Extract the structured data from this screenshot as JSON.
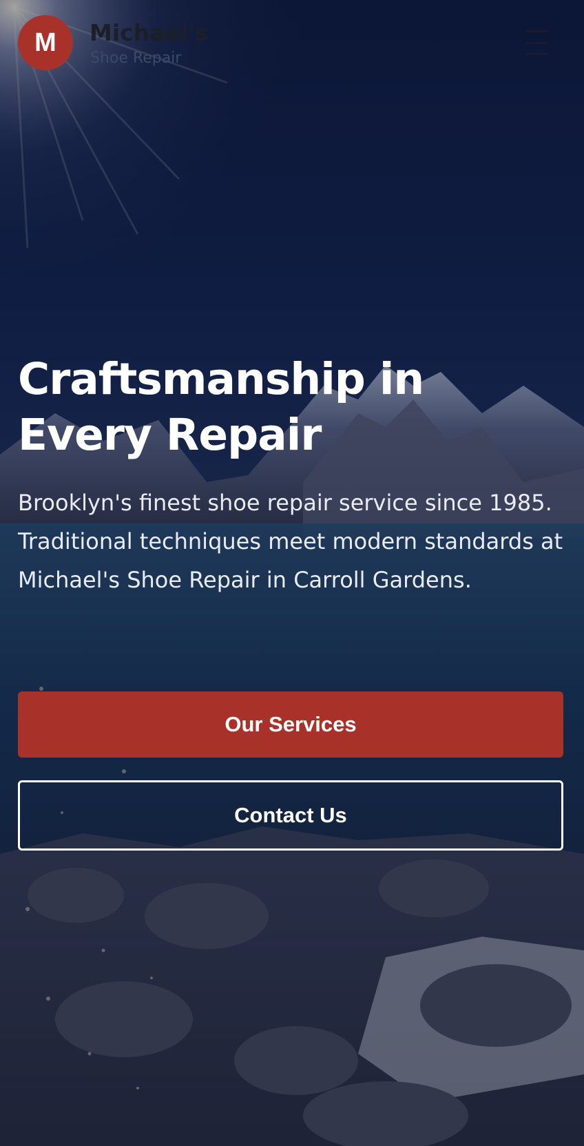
{
  "header": {
    "logo_letter": "M",
    "brand_name": "Michael's",
    "brand_subtitle": "Shoe Repair",
    "menu_icon": "hamburger-menu-icon"
  },
  "hero": {
    "title": "Craftsmanship in Every Repair",
    "description": "Brooklyn's finest shoe repair service since 1985. Traditional techniques meet modern standards at Michael's Shoe Repair in Carroll Gardens.",
    "primary_button": "Our Services",
    "secondary_button": "Contact Us"
  },
  "colors": {
    "accent": "#a8322a",
    "text_light": "#ffffff",
    "brand_dark": "#1d1f28"
  }
}
